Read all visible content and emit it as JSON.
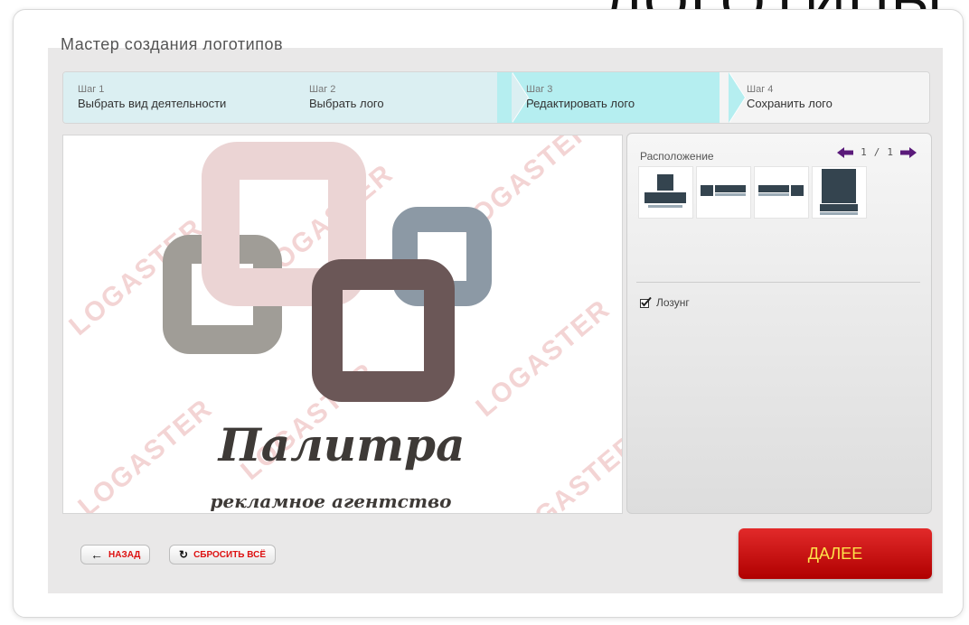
{
  "slide": {
    "title": "ЛОГОТИПЫ"
  },
  "wizard": {
    "title": "Мастер создания логотипов"
  },
  "steps": [
    {
      "num": "Шаг 1",
      "label": "Выбрать вид деятельности"
    },
    {
      "num": "Шаг 2",
      "label": "Выбрать лого"
    },
    {
      "num": "Шаг 3",
      "label": "Редактировать лого"
    },
    {
      "num": "Шаг 4",
      "label": "Сохранить лого"
    }
  ],
  "logo": {
    "name": "Палитра",
    "tagline": "рекламное агентство"
  },
  "watermark": "LOGASTER",
  "panel": {
    "layout_label": "Расположение",
    "pager_current": "1",
    "pager_sep": "/",
    "pager_total": "1",
    "slogan_label": "Лозунг",
    "slogan_checked": true
  },
  "buttons": {
    "back": "НАЗАД",
    "reset": "СБРОСИТЬ ВСЁ",
    "next": "ДАЛЕЕ"
  },
  "colors": {
    "active_step": "#b5eef0",
    "done_step": "#dbeff2",
    "next_button": "#c70d0d",
    "next_text": "#fde14a",
    "pager_arrows": "#5a1a7a",
    "logo_pink": "#ebd4d4",
    "logo_grey": "#a09d97",
    "logo_blue": "#8c99a5",
    "logo_brown": "#6b5757"
  }
}
